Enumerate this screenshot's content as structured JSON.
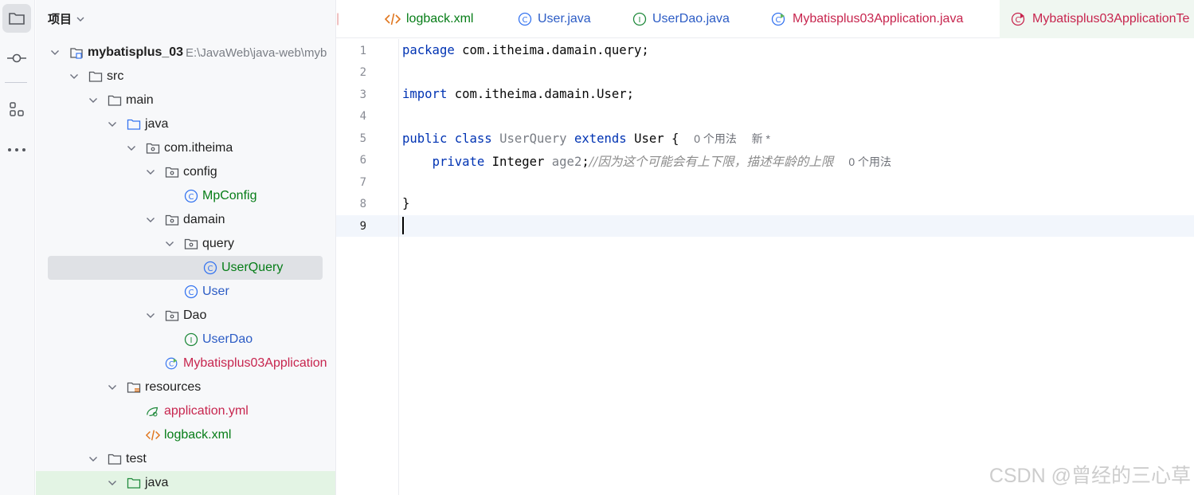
{
  "toolwindow": {
    "title": "项目"
  },
  "tree": [
    {
      "label": "mybatisplus_03",
      "path": "E:\\JavaWeb\\java-web\\myb"
    },
    {
      "label": "src"
    },
    {
      "label": "main"
    },
    {
      "label": "java"
    },
    {
      "label": "com.itheima"
    },
    {
      "label": "config"
    },
    {
      "label": "MpConfig"
    },
    {
      "label": "damain"
    },
    {
      "label": "query"
    },
    {
      "label": "UserQuery"
    },
    {
      "label": "User"
    },
    {
      "label": "Dao"
    },
    {
      "label": "UserDao"
    },
    {
      "label": "Mybatisplus03Application"
    },
    {
      "label": "resources"
    },
    {
      "label": "application.yml"
    },
    {
      "label": "logback.xml"
    },
    {
      "label": "test"
    },
    {
      "label": "java"
    }
  ],
  "tabs": [
    {
      "label": "logback.xml"
    },
    {
      "label": "User.java"
    },
    {
      "label": "UserDao.java"
    },
    {
      "label": "Mybatisplus03Application.java"
    },
    {
      "label": "Mybatisplus03ApplicationTe"
    }
  ],
  "editor": {
    "line_numbers": [
      "1",
      "2",
      "3",
      "4",
      "5",
      "6",
      "7",
      "8",
      "9"
    ],
    "line1": {
      "kw": "package",
      "rest": " com.itheima.damain.query;"
    },
    "line3": {
      "kw": "import",
      "rest": " com.itheima.damain.User;"
    },
    "line5": {
      "kw1": "public",
      "kw2": "class",
      "name": "UserQuery",
      "kw3": "extends",
      "rest": " User {",
      "hint1": "0 个用法",
      "hint2": "新 *"
    },
    "line6": {
      "kw": "private",
      "type": " Integer ",
      "field": "age2",
      "semi": ";",
      "comment": "//因为这个可能会有上下限，描述年龄的上限",
      "hint": "0 个用法"
    },
    "line8": {
      "text": "}"
    }
  },
  "watermark": "CSDN @曾经的三心草",
  "colors": {
    "keyword": "#0033b3",
    "class_green": "#067d17",
    "class_red": "#c7254e",
    "comment": "#8c8c8c",
    "selection": "#dfe1e5"
  }
}
